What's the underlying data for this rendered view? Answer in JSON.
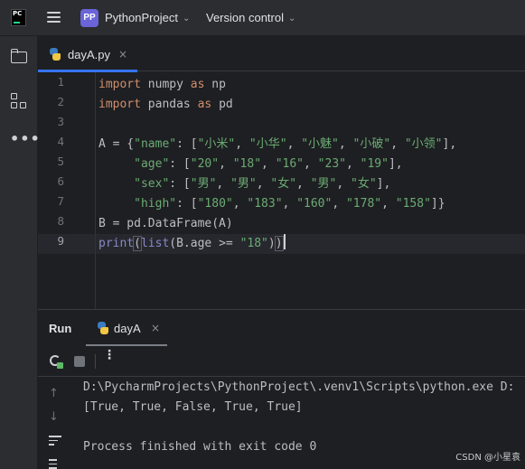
{
  "titlebar": {
    "logo_text": "PC",
    "project_badge": "PP",
    "project_name": "PythonProject",
    "vcs_label": "Version control"
  },
  "leftbar": {
    "icons": [
      "folder-icon",
      "structure-icon",
      "more-icon"
    ]
  },
  "editor_tab": {
    "filename": "dayA.py",
    "close": "×"
  },
  "editor": {
    "current_line": 9,
    "lines": [
      {
        "n": "1",
        "segs": [
          [
            "kw",
            "import"
          ],
          [
            "p",
            " numpy "
          ],
          [
            "kw",
            "as"
          ],
          [
            "p",
            " np"
          ]
        ]
      },
      {
        "n": "2",
        "segs": [
          [
            "kw",
            "import"
          ],
          [
            "p",
            " pandas "
          ],
          [
            "kw",
            "as"
          ],
          [
            "p",
            " pd"
          ]
        ]
      },
      {
        "n": "3",
        "segs": []
      },
      {
        "n": "4",
        "segs": [
          [
            "p",
            "A = {"
          ],
          [
            "str",
            "\"name\""
          ],
          [
            "p",
            ": ["
          ],
          [
            "str",
            "\"小米\""
          ],
          [
            "p",
            ", "
          ],
          [
            "str",
            "\"小华\""
          ],
          [
            "p",
            ", "
          ],
          [
            "str",
            "\"小魅\""
          ],
          [
            "p",
            ", "
          ],
          [
            "str",
            "\"小破\""
          ],
          [
            "p",
            ", "
          ],
          [
            "str",
            "\"小领\""
          ],
          [
            "p",
            "],"
          ]
        ]
      },
      {
        "n": "5",
        "segs": [
          [
            "p",
            "     "
          ],
          [
            "str",
            "\"age\""
          ],
          [
            "p",
            ": ["
          ],
          [
            "str",
            "\"20\""
          ],
          [
            "p",
            ", "
          ],
          [
            "str",
            "\"18\""
          ],
          [
            "p",
            ", "
          ],
          [
            "str",
            "\"16\""
          ],
          [
            "p",
            ", "
          ],
          [
            "str",
            "\"23\""
          ],
          [
            "p",
            ", "
          ],
          [
            "str",
            "\"19\""
          ],
          [
            "p",
            "],"
          ]
        ]
      },
      {
        "n": "6",
        "segs": [
          [
            "p",
            "     "
          ],
          [
            "str",
            "\"sex\""
          ],
          [
            "p",
            ": ["
          ],
          [
            "str",
            "\"男\""
          ],
          [
            "p",
            ", "
          ],
          [
            "str",
            "\"男\""
          ],
          [
            "p",
            ", "
          ],
          [
            "str",
            "\"女\""
          ],
          [
            "p",
            ", "
          ],
          [
            "str",
            "\"男\""
          ],
          [
            "p",
            ", "
          ],
          [
            "str",
            "\"女\""
          ],
          [
            "p",
            "],"
          ]
        ]
      },
      {
        "n": "7",
        "segs": [
          [
            "p",
            "     "
          ],
          [
            "str",
            "\"high\""
          ],
          [
            "p",
            ": ["
          ],
          [
            "str",
            "\"180\""
          ],
          [
            "p",
            ", "
          ],
          [
            "str",
            "\"183\""
          ],
          [
            "p",
            ", "
          ],
          [
            "str",
            "\"160\""
          ],
          [
            "p",
            ", "
          ],
          [
            "str",
            "\"178\""
          ],
          [
            "p",
            ", "
          ],
          [
            "str",
            "\"158\""
          ],
          [
            "p",
            "]}"
          ]
        ]
      },
      {
        "n": "8",
        "segs": [
          [
            "p",
            "B = pd.DataFrame(A)"
          ]
        ]
      },
      {
        "n": "9",
        "segs": [
          [
            "bi",
            "print"
          ],
          [
            "brm",
            "("
          ],
          [
            "bi",
            "list"
          ],
          [
            "p",
            "(B.age >= "
          ],
          [
            "str",
            "\"18\""
          ],
          [
            "p",
            ")"
          ],
          [
            "brm",
            ")"
          ]
        ]
      }
    ]
  },
  "run_panel": {
    "title": "Run",
    "tab_name": "dayA",
    "close": "×",
    "toolbar": {
      "more": "⋮"
    },
    "console_lines": [
      "D:\\PycharmProjects\\PythonProject\\.venv1\\Scripts\\python.exe D:",
      "[True, True, False, True, True]",
      "",
      "Process finished with exit code 0"
    ]
  },
  "watermark": "CSDN @小星袁",
  "colors": {
    "keyword": "#cf8e6d",
    "string": "#6aab73",
    "builtin": "#8888c6",
    "accent": "#3574f0"
  }
}
